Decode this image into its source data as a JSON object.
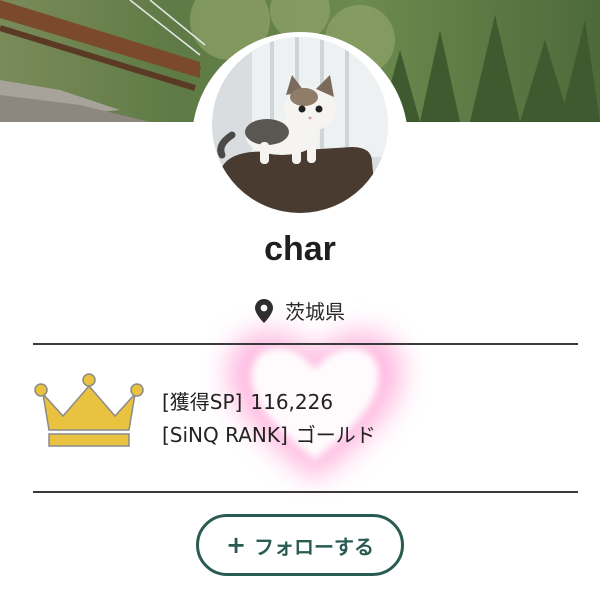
{
  "profile": {
    "username": "char",
    "location": "茨城県"
  },
  "stats": {
    "points_label": "[獲得SP]",
    "points_value": "116,226",
    "rank_label": "[SiNQ RANK]",
    "rank_value": "ゴールド"
  },
  "actions": {
    "follow_plus": "+",
    "follow_label": "フォローする"
  },
  "colors": {
    "accent": "#2a5b53",
    "crown": "#e9c33f",
    "divider": "#3a3a3a"
  },
  "icons": {
    "location": "map-pin-icon",
    "rank": "crown-icon"
  }
}
